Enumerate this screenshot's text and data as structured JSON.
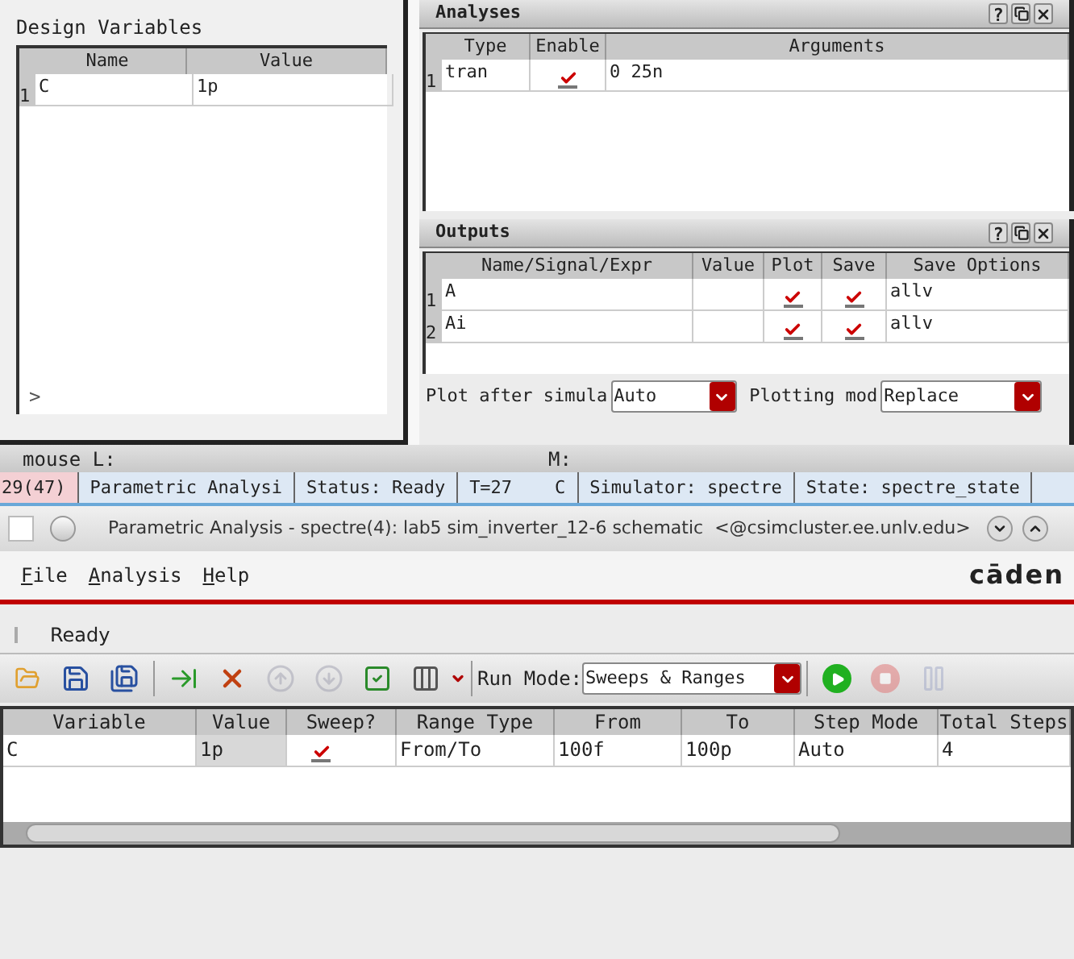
{
  "design_variables": {
    "title": "Design Variables",
    "columns": [
      "Name",
      "Value"
    ],
    "rows": [
      {
        "index": "1",
        "name": "C",
        "value": "1p"
      }
    ],
    "expander": ">"
  },
  "analyses": {
    "title": "Analyses",
    "help": "?",
    "columns": [
      "Type",
      "Enable",
      "Arguments"
    ],
    "rows": [
      {
        "index": "1",
        "type": "tran",
        "enabled": true,
        "arguments": "0 25n"
      }
    ]
  },
  "outputs": {
    "title": "Outputs",
    "help": "?",
    "columns": [
      "Name/Signal/Expr",
      "Value",
      "Plot",
      "Save",
      "Save Options"
    ],
    "rows": [
      {
        "index": "1",
        "name": "A",
        "plot": true,
        "save": true,
        "save_options": "allv"
      },
      {
        "index": "2",
        "name": "Ai",
        "plot": true,
        "save": true,
        "save_options": "allv"
      }
    ],
    "plot_after": {
      "label": "Plot after simula",
      "value": "Auto"
    },
    "plotting_mode": {
      "label": "Plotting mod",
      "value": "Replace"
    }
  },
  "mouse_bar": {
    "left": "mouse L:",
    "middle": "M:"
  },
  "status_bar": [
    {
      "text": "29(47)",
      "highlighted": true
    },
    {
      "text": "Parametric Analysi",
      "highlighted": false
    },
    {
      "text": "Status: Ready",
      "highlighted": false
    },
    {
      "text": "T=27    C",
      "highlighted": false
    },
    {
      "text": "Simulator: spectre",
      "highlighted": false
    },
    {
      "text": "State: spectre_state",
      "highlighted": false
    }
  ],
  "window": {
    "title": "Parametric Analysis - spectre(4): lab5 sim_inverter_12-6 schematic  <@csimcluster.ee.unlv.edu>"
  },
  "menus": [
    {
      "label": "File"
    },
    {
      "label": "Analysis"
    },
    {
      "label": "Help"
    }
  ],
  "logo": "cāden",
  "ready_bar": {
    "text": "Ready"
  },
  "toolbar": [
    {
      "kind": "open",
      "disabled": false
    },
    {
      "kind": "save",
      "disabled": false
    },
    {
      "kind": "save-as",
      "disabled": false
    },
    {
      "kind": "separator"
    },
    {
      "kind": "add",
      "disabled": false
    },
    {
      "kind": "delete",
      "disabled": false
    },
    {
      "kind": "up",
      "disabled": true
    },
    {
      "kind": "down",
      "disabled": true
    },
    {
      "kind": "check",
      "disabled": false
    },
    {
      "kind": "columns",
      "disabled": false
    }
  ],
  "run_mode": {
    "label": "Run Mode:",
    "value": "Sweeps & Ranges"
  },
  "run_controls": [
    {
      "kind": "run",
      "disabled": false
    },
    {
      "kind": "stop",
      "disabled": true
    },
    {
      "kind": "pause",
      "disabled": true
    }
  ],
  "sweep_table": {
    "columns": [
      "Variable",
      "Value",
      "Sweep?",
      "Range Type",
      "From",
      "To",
      "Step Mode",
      "Total Steps"
    ],
    "rows": [
      {
        "variable": "C",
        "value": "1p",
        "sweep": true,
        "range_type": "From/To",
        "from": "100f",
        "to": "100p",
        "step_mode": "Auto",
        "total_steps": "4"
      }
    ]
  }
}
